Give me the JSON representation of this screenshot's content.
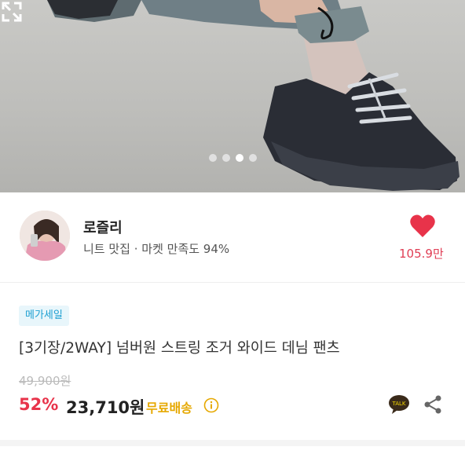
{
  "product_image": {
    "alt": "black chunky sneakers with joggers",
    "carousel_count": 4,
    "active_index": 2
  },
  "seller": {
    "name": "로즐리",
    "subtitle": "니트 맛집 · 마켓 만족도 94%",
    "like_count": "105.9만"
  },
  "product": {
    "badge": "메가세일",
    "title": "[3기장/2WAY] 넘버원 스트링 조거 와이드 데님 팬츠",
    "original_price": "49,900원",
    "discount": "52%",
    "price": "23,710원",
    "shipping": "무료배송"
  },
  "icons": {
    "expand": "expand-icon",
    "heart": "heart-icon",
    "info": "info-icon",
    "talk": "kakaotalk-icon",
    "share": "share-icon"
  },
  "talk_label": "TALK",
  "colors": {
    "heart": "#e8334a",
    "discount": "#e8334a",
    "shipping": "#e6a800",
    "badge_text": "#1c9fd1"
  }
}
